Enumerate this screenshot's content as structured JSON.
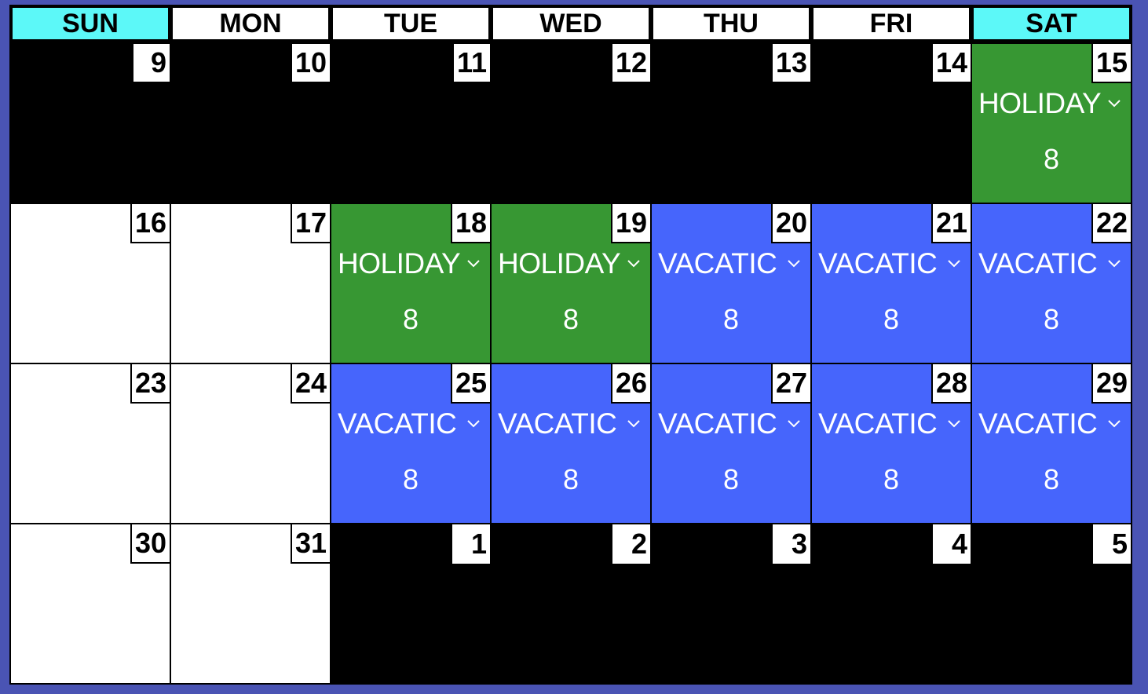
{
  "calendar": {
    "weekdays": [
      {
        "label": "SUN",
        "color": "#5cf8f8"
      },
      {
        "label": "MON",
        "color": "#ffffff"
      },
      {
        "label": "TUE",
        "color": "#ffffff"
      },
      {
        "label": "WED",
        "color": "#ffffff"
      },
      {
        "label": "THU",
        "color": "#ffffff"
      },
      {
        "label": "FRI",
        "color": "#ffffff"
      },
      {
        "label": "SAT",
        "color": "#5cf8f8"
      }
    ],
    "colors": {
      "holiday": "#379733",
      "vacation": "#4665fc",
      "empty": "#ffffff",
      "disabled": "#000000",
      "frame": "#4a54b4"
    },
    "weeks": [
      [
        {
          "day": "9",
          "state": "disabled"
        },
        {
          "day": "10",
          "state": "disabled"
        },
        {
          "day": "11",
          "state": "disabled"
        },
        {
          "day": "12",
          "state": "disabled"
        },
        {
          "day": "13",
          "state": "disabled"
        },
        {
          "day": "14",
          "state": "disabled"
        },
        {
          "day": "15",
          "state": "holiday",
          "type": "HOLIDAY",
          "hours": "8"
        }
      ],
      [
        {
          "day": "16",
          "state": "empty"
        },
        {
          "day": "17",
          "state": "empty"
        },
        {
          "day": "18",
          "state": "holiday",
          "type": "HOLIDAY",
          "hours": "8"
        },
        {
          "day": "19",
          "state": "holiday",
          "type": "HOLIDAY",
          "hours": "8"
        },
        {
          "day": "20",
          "state": "vacation",
          "type": "VACATIC",
          "hours": "8"
        },
        {
          "day": "21",
          "state": "vacation",
          "type": "VACATIC",
          "hours": "8"
        },
        {
          "day": "22",
          "state": "vacation",
          "type": "VACATIC",
          "hours": "8"
        }
      ],
      [
        {
          "day": "23",
          "state": "empty"
        },
        {
          "day": "24",
          "state": "empty"
        },
        {
          "day": "25",
          "state": "vacation",
          "type": "VACATIC",
          "hours": "8"
        },
        {
          "day": "26",
          "state": "vacation",
          "type": "VACATIC",
          "hours": "8"
        },
        {
          "day": "27",
          "state": "vacation",
          "type": "VACATIC",
          "hours": "8"
        },
        {
          "day": "28",
          "state": "vacation",
          "type": "VACATIC",
          "hours": "8"
        },
        {
          "day": "29",
          "state": "vacation",
          "type": "VACATIC",
          "hours": "8"
        }
      ],
      [
        {
          "day": "30",
          "state": "empty"
        },
        {
          "day": "31",
          "state": "empty"
        },
        {
          "day": "1",
          "state": "outside"
        },
        {
          "day": "2",
          "state": "outside"
        },
        {
          "day": "3",
          "state": "outside"
        },
        {
          "day": "4",
          "state": "outside"
        },
        {
          "day": "5",
          "state": "outside"
        }
      ]
    ]
  }
}
